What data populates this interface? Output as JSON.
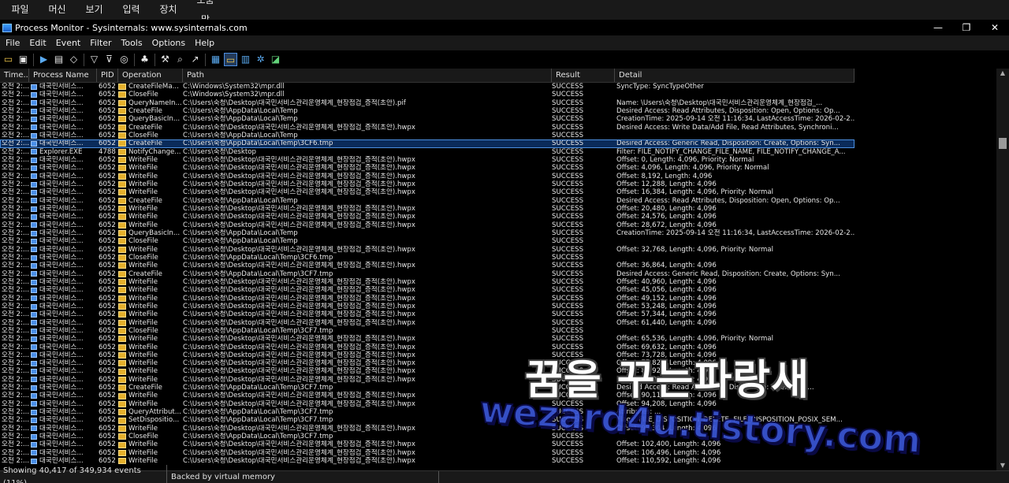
{
  "vm_menu": [
    "파일",
    "머신",
    "보기",
    "입력",
    "장치",
    "도움말"
  ],
  "window": {
    "title": "Process Monitor - Sysinternals: www.sysinternals.com",
    "minimize": "—",
    "restore": "❐",
    "close": "✕"
  },
  "menu": [
    "File",
    "Edit",
    "Event",
    "Filter",
    "Tools",
    "Options",
    "Help"
  ],
  "toolbar_icons": [
    "open-icon",
    "save-icon",
    "capture-icon",
    "autoscroll-icon",
    "clear-icon",
    "filter-icon",
    "highlight-icon",
    "include-process-icon",
    "process-tree-icon",
    "properties-icon",
    "find-icon",
    "jump-icon",
    "registry-activity-icon",
    "filesystem-activity-icon",
    "network-activity-icon",
    "process-thread-activity-icon",
    "profiling-events-icon"
  ],
  "columns": [
    "Time...",
    "Process Name",
    "PID",
    "Operation",
    "Path",
    "Result",
    "Detail"
  ],
  "rows": [
    [
      "오전 2:...",
      "대국민서비스...",
      "6052",
      "CreateFileMa...",
      "C:\\Windows\\System32\\mpr.dll",
      "SUCCESS",
      "SyncType: SyncTypeOther"
    ],
    [
      "오전 2:...",
      "대국민서비스...",
      "6052",
      "CloseFile",
      "C:\\Windows\\System32\\mpr.dll",
      "SUCCESS",
      ""
    ],
    [
      "오전 2:...",
      "대국민서비스...",
      "6052",
      "QueryNameIn...",
      "C:\\Users\\숙청\\Desktop\\대국민서비스관리운영체계_현장점검_증적(초안).pif",
      "SUCCESS",
      "Name: \\Users\\숙청\\Desktop\\대국민서비스관리운영체계_현장점검_..."
    ],
    [
      "오전 2:...",
      "대국민서비스...",
      "6052",
      "CreateFile",
      "C:\\Users\\숙청\\AppData\\Local\\Temp",
      "SUCCESS",
      "Desired Access: Read Attributes, Disposition: Open, Options: Op..."
    ],
    [
      "오전 2:...",
      "대국민서비스...",
      "6052",
      "QueryBasicIn...",
      "C:\\Users\\숙청\\AppData\\Local\\Temp",
      "SUCCESS",
      "CreationTime: 2025-09-14 오전 11:16:34, LastAccessTime: 2026-02-2..."
    ],
    [
      "오전 2:...",
      "대국민서비스...",
      "6052",
      "CreateFile",
      "C:\\Users\\숙청\\Desktop\\대국민서비스관리운영체계_현장점검_증적(초안).hwpx",
      "SUCCESS",
      "Desired Access: Write Data/Add File, Read Attributes, Synchroni..."
    ],
    [
      "오전 2:...",
      "대국민서비스...",
      "6052",
      "CloseFile",
      "C:\\Users\\숙청\\AppData\\Local\\Temp",
      "SUCCESS",
      ""
    ],
    [
      "오전 2:...",
      "대국민서비스...",
      "6052",
      "CreateFile",
      "C:\\Users\\숙청\\AppData\\Local\\Temp\\3CF6.tmp",
      "SUCCESS",
      "Desired Access: Generic Read, Disposition: Create, Options: Syn..."
    ],
    [
      "오전 2:...",
      "Explorer.EXE",
      "4788",
      "NotifyChange...",
      "C:\\Users\\숙청\\Desktop",
      "SUCCESS",
      "Filter: FILE_NOTIFY_CHANGE_FILE_NAME, FILE_NOTIFY_CHANGE_A..."
    ],
    [
      "오전 2:...",
      "대국민서비스...",
      "6052",
      "WriteFile",
      "C:\\Users\\숙청\\Desktop\\대국민서비스관리운영체계_현장점검_증적(초안).hwpx",
      "SUCCESS",
      "Offset: 0, Length: 4,096, Priority: Normal"
    ],
    [
      "오전 2:...",
      "대국민서비스...",
      "6052",
      "WriteFile",
      "C:\\Users\\숙청\\Desktop\\대국민서비스관리운영체계_현장점검_증적(초안).hwpx",
      "SUCCESS",
      "Offset: 4,096, Length: 4,096, Priority: Normal"
    ],
    [
      "오전 2:...",
      "대국민서비스...",
      "6052",
      "WriteFile",
      "C:\\Users\\숙청\\Desktop\\대국민서비스관리운영체계_현장점검_증적(초안).hwpx",
      "SUCCESS",
      "Offset: 8,192, Length: 4,096"
    ],
    [
      "오전 2:...",
      "대국민서비스...",
      "6052",
      "WriteFile",
      "C:\\Users\\숙청\\Desktop\\대국민서비스관리운영체계_현장점검_증적(초안).hwpx",
      "SUCCESS",
      "Offset: 12,288, Length: 4,096"
    ],
    [
      "오전 2:...",
      "대국민서비스...",
      "6052",
      "WriteFile",
      "C:\\Users\\숙청\\Desktop\\대국민서비스관리운영체계_현장점검_증적(초안).hwpx",
      "SUCCESS",
      "Offset: 16,384, Length: 4,096, Priority: Normal"
    ],
    [
      "오전 2:...",
      "대국민서비스...",
      "6052",
      "CreateFile",
      "C:\\Users\\숙청\\AppData\\Local\\Temp",
      "SUCCESS",
      "Desired Access: Read Attributes, Disposition: Open, Options: Op..."
    ],
    [
      "오전 2:...",
      "대국민서비스...",
      "6052",
      "WriteFile",
      "C:\\Users\\숙청\\Desktop\\대국민서비스관리운영체계_현장점검_증적(초안).hwpx",
      "SUCCESS",
      "Offset: 20,480, Length: 4,096"
    ],
    [
      "오전 2:...",
      "대국민서비스...",
      "6052",
      "WriteFile",
      "C:\\Users\\숙청\\Desktop\\대국민서비스관리운영체계_현장점검_증적(초안).hwpx",
      "SUCCESS",
      "Offset: 24,576, Length: 4,096"
    ],
    [
      "오전 2:...",
      "대국민서비스...",
      "6052",
      "WriteFile",
      "C:\\Users\\숙청\\Desktop\\대국민서비스관리운영체계_현장점검_증적(초안).hwpx",
      "SUCCESS",
      "Offset: 28,672, Length: 4,096"
    ],
    [
      "오전 2:...",
      "대국민서비스...",
      "6052",
      "QueryBasicIn...",
      "C:\\Users\\숙청\\AppData\\Local\\Temp",
      "SUCCESS",
      "CreationTime: 2025-09-14 오전 11:16:34, LastAccessTime: 2026-02-2..."
    ],
    [
      "오전 2:...",
      "대국민서비스...",
      "6052",
      "CloseFile",
      "C:\\Users\\숙청\\AppData\\Local\\Temp",
      "SUCCESS",
      ""
    ],
    [
      "오전 2:...",
      "대국민서비스...",
      "6052",
      "WriteFile",
      "C:\\Users\\숙청\\Desktop\\대국민서비스관리운영체계_현장점검_증적(초안).hwpx",
      "SUCCESS",
      "Offset: 32,768, Length: 4,096, Priority: Normal"
    ],
    [
      "오전 2:...",
      "대국민서비스...",
      "6052",
      "CloseFile",
      "C:\\Users\\숙청\\AppData\\Local\\Temp\\3CF6.tmp",
      "SUCCESS",
      ""
    ],
    [
      "오전 2:...",
      "대국민서비스...",
      "6052",
      "WriteFile",
      "C:\\Users\\숙청\\Desktop\\대국민서비스관리운영체계_현장점검_증적(초안).hwpx",
      "SUCCESS",
      "Offset: 36,864, Length: 4,096"
    ],
    [
      "오전 2:...",
      "대국민서비스...",
      "6052",
      "CreateFile",
      "C:\\Users\\숙청\\AppData\\Local\\Temp\\3CF7.tmp",
      "SUCCESS",
      "Desired Access: Generic Read, Disposition: Create, Options: Syn..."
    ],
    [
      "오전 2:...",
      "대국민서비스...",
      "6052",
      "WriteFile",
      "C:\\Users\\숙청\\Desktop\\대국민서비스관리운영체계_현장점검_증적(초안).hwpx",
      "SUCCESS",
      "Offset: 40,960, Length: 4,096"
    ],
    [
      "오전 2:...",
      "대국민서비스...",
      "6052",
      "WriteFile",
      "C:\\Users\\숙청\\Desktop\\대국민서비스관리운영체계_현장점검_증적(초안).hwpx",
      "SUCCESS",
      "Offset: 45,056, Length: 4,096"
    ],
    [
      "오전 2:...",
      "대국민서비스...",
      "6052",
      "WriteFile",
      "C:\\Users\\숙청\\Desktop\\대국민서비스관리운영체계_현장점검_증적(초안).hwpx",
      "SUCCESS",
      "Offset: 49,152, Length: 4,096"
    ],
    [
      "오전 2:...",
      "대국민서비스...",
      "6052",
      "WriteFile",
      "C:\\Users\\숙청\\Desktop\\대국민서비스관리운영체계_현장점검_증적(초안).hwpx",
      "SUCCESS",
      "Offset: 53,248, Length: 4,096"
    ],
    [
      "오전 2:...",
      "대국민서비스...",
      "6052",
      "WriteFile",
      "C:\\Users\\숙청\\Desktop\\대국민서비스관리운영체계_현장점검_증적(초안).hwpx",
      "SUCCESS",
      "Offset: 57,344, Length: 4,096"
    ],
    [
      "오전 2:...",
      "대국민서비스...",
      "6052",
      "WriteFile",
      "C:\\Users\\숙청\\Desktop\\대국민서비스관리운영체계_현장점검_증적(초안).hwpx",
      "SUCCESS",
      "Offset: 61,440, Length: 4,096"
    ],
    [
      "오전 2:...",
      "대국민서비스...",
      "6052",
      "CloseFile",
      "C:\\Users\\숙청\\AppData\\Local\\Temp\\3CF7.tmp",
      "SUCCESS",
      ""
    ],
    [
      "오전 2:...",
      "대국민서비스...",
      "6052",
      "WriteFile",
      "C:\\Users\\숙청\\Desktop\\대국민서비스관리운영체계_현장점검_증적(초안).hwpx",
      "SUCCESS",
      "Offset: 65,536, Length: 4,096, Priority: Normal"
    ],
    [
      "오전 2:...",
      "대국민서비스...",
      "6052",
      "WriteFile",
      "C:\\Users\\숙청\\Desktop\\대국민서비스관리운영체계_현장점검_증적(초안).hwpx",
      "SUCCESS",
      "Offset: 69,632, Length: 4,096"
    ],
    [
      "오전 2:...",
      "대국민서비스...",
      "6052",
      "WriteFile",
      "C:\\Users\\숙청\\Desktop\\대국민서비스관리운영체계_현장점검_증적(초안).hwpx",
      "SUCCESS",
      "Offset: 73,728, Length: 4,096"
    ],
    [
      "오전 2:...",
      "대국민서비스...",
      "6052",
      "WriteFile",
      "C:\\Users\\숙청\\Desktop\\대국민서비스관리운영체계_현장점검_증적(초안).hwpx",
      "SUCCESS",
      "Offset: 77,824, Length: 4,096"
    ],
    [
      "오전 2:...",
      "대국민서비스...",
      "6052",
      "WriteFile",
      "C:\\Users\\숙청\\Desktop\\대국민서비스관리운영체계_현장점검_증적(초안).hwpx",
      "SUCCESS",
      "Offset: 81,920, Length: 4,096"
    ],
    [
      "오전 2:...",
      "대국민서비스...",
      "6052",
      "WriteFile",
      "C:\\Users\\숙청\\Desktop\\대국민서비스관리운영체계_현장점검_증적(초안).hwpx",
      "SUCCESS",
      "Offset: 86,016, Length: 4,096"
    ],
    [
      "오전 2:...",
      "대국민서비스...",
      "6052",
      "CreateFile",
      "C:\\Users\\숙청\\AppData\\Local\\Temp\\3CF7.tmp",
      "SUCCESS",
      "Desired Access: Read Attributes, Disposition: Open, Opti..."
    ],
    [
      "오전 2:...",
      "대국민서비스...",
      "6052",
      "WriteFile",
      "C:\\Users\\숙청\\Desktop\\대국민서비스관리운영체계_현장점검_증적(초안).hwpx",
      "SUCCESS",
      "Offset: 90,112, Length: 4,096"
    ],
    [
      "오전 2:...",
      "대국민서비스...",
      "6052",
      "WriteFile",
      "C:\\Users\\숙청\\Desktop\\대국민서비스관리운영체계_현장점검_증적(초안).hwpx",
      "SUCCESS",
      "Offset: 94,208, Length: 4,096"
    ],
    [
      "오전 2:...",
      "대국민서비스...",
      "6052",
      "QueryAttribut...",
      "C:\\Users\\숙청\\AppData\\Local\\Temp\\3CF7.tmp",
      "SUCCESS",
      "Attributes: ..."
    ],
    [
      "오전 2:...",
      "대국민서비스...",
      "6052",
      "SetDispositio...",
      "C:\\Users\\숙청\\AppData\\Local\\Temp\\3CF7.tmp",
      "SUCCESS",
      "Flags: FILE_DISPOSITION_DELETE, FILE_DISPOSITION_POSIX_SEM..."
    ],
    [
      "오전 2:...",
      "대국민서비스...",
      "6052",
      "WriteFile",
      "C:\\Users\\숙청\\Desktop\\대국민서비스관리운영체계_현장점검_증적(초안).hwpx",
      "SUCCESS",
      "Offset: 98,304, Length: 4,096"
    ],
    [
      "오전 2:...",
      "대국민서비스...",
      "6052",
      "CloseFile",
      "C:\\Users\\숙청\\AppData\\Local\\Temp\\3CF7.tmp",
      "SUCCESS",
      ""
    ],
    [
      "오전 2:...",
      "대국민서비스...",
      "6052",
      "WriteFile",
      "C:\\Users\\숙청\\Desktop\\대국민서비스관리운영체계_현장점검_증적(초안).hwpx",
      "SUCCESS",
      "Offset: 102,400, Length: 4,096"
    ],
    [
      "오전 2:...",
      "대국민서비스...",
      "6052",
      "WriteFile",
      "C:\\Users\\숙청\\Desktop\\대국민서비스관리운영체계_현장점검_증적(초안).hwpx",
      "SUCCESS",
      "Offset: 106,496, Length: 4,096"
    ],
    [
      "오전 2:...",
      "대국민서비스...",
      "6052",
      "WriteFile",
      "C:\\Users\\숙청\\Desktop\\대국민서비스관리운영체계_현장점검_증적(초안).hwpx",
      "SUCCESS",
      "Offset: 110,592, Length: 4,096"
    ]
  ],
  "selected_row": 7,
  "status": {
    "events": "Showing 40,417 of 349,934 events (11%)",
    "memory": "Backed by virtual memory"
  },
  "watermark": {
    "line1": "꿈을 꾸는파랑새",
    "line2": "wezard4u.tistory.com"
  }
}
